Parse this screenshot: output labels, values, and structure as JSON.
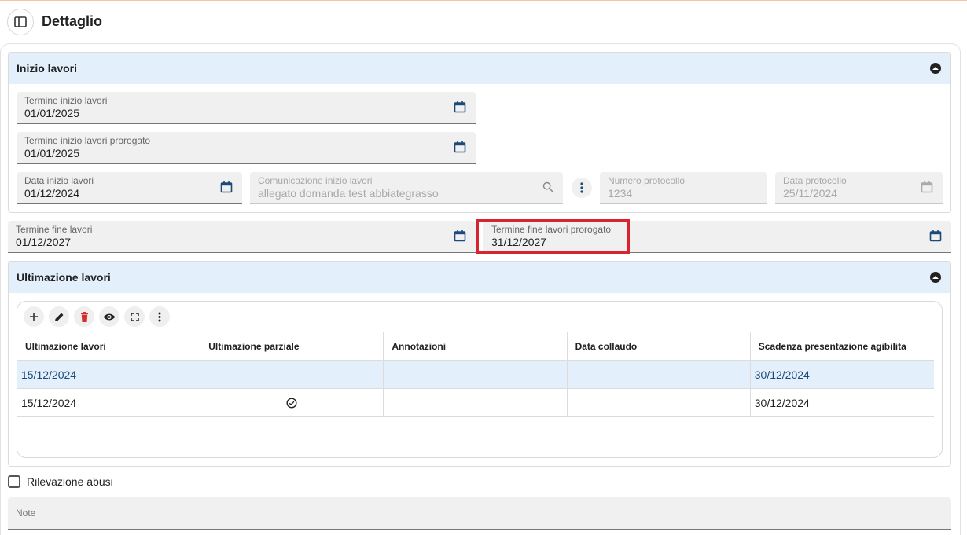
{
  "header": {
    "title": "Dettaglio",
    "toggle_icon": "sidebar-toggle-icon"
  },
  "inizio": {
    "title": "Inizio lavori",
    "termine_inizio": {
      "label": "Termine inizio lavori",
      "value": "01/01/2025"
    },
    "termine_inizio_prorogato": {
      "label": "Termine inizio lavori prorogato",
      "value": "01/01/2025"
    },
    "data_inizio": {
      "label": "Data inizio lavori",
      "value": "01/12/2024"
    },
    "comunicazione": {
      "label": "Comunicazione inizio lavori",
      "value": "allegato domanda test abbiategrasso"
    },
    "numero_protocollo": {
      "label": "Numero protocollo",
      "value": "1234"
    },
    "data_protocollo": {
      "label": "Data protocollo",
      "value": "25/11/2024"
    }
  },
  "fine": {
    "termine_fine": {
      "label": "Termine fine lavori",
      "value": "01/12/2027"
    },
    "termine_fine_prorogato": {
      "label": "Termine fine lavori prorogato",
      "value": "31/12/2027"
    }
  },
  "ultimazione": {
    "title": "Ultimazione lavori",
    "columns": [
      "Ultimazione lavori",
      "Ultimazione parziale",
      "Annotazioni",
      "Data collaudo",
      "Scadenza presentazione agibilita"
    ],
    "rows": [
      {
        "ultimazione": "15/12/2024",
        "parziale": "",
        "annotazioni": "",
        "collaudo": "",
        "scadenza": "30/12/2024",
        "selected": true
      },
      {
        "ultimazione": "15/12/2024",
        "parziale": "check",
        "annotazioni": "",
        "collaudo": "",
        "scadenza": "30/12/2024",
        "selected": false
      }
    ]
  },
  "rilevazione": {
    "label": "Rilevazione abusi",
    "checked": false
  },
  "note": {
    "label": "Note",
    "value": ""
  },
  "colors": {
    "accent": "#1b4a78",
    "section_header": "#e3f0fc",
    "highlight": "#d9232e",
    "delete": "#d32f2f"
  }
}
